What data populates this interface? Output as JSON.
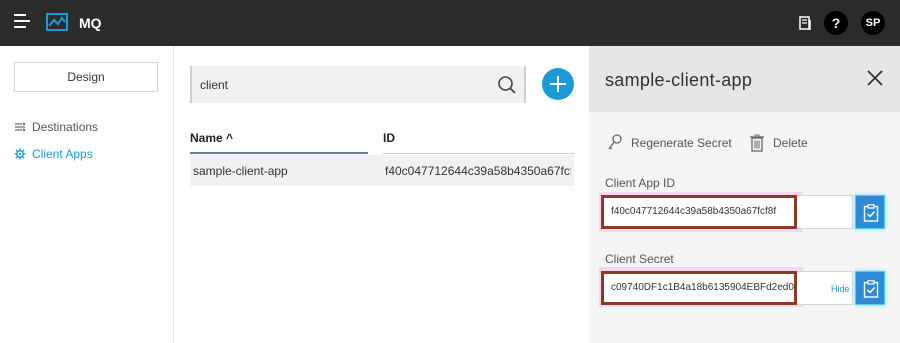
{
  "app": {
    "brand": "MQ",
    "help_label": "?",
    "avatar_initials": "SP"
  },
  "nav": {
    "design_label": "Design",
    "items": [
      {
        "label": "Destinations",
        "icon": "destinations-icon",
        "active": false
      },
      {
        "label": "Client Apps",
        "icon": "gear-icon",
        "active": true
      }
    ]
  },
  "search": {
    "value": "client",
    "placeholder": ""
  },
  "table": {
    "headers": {
      "name": "Name ^",
      "id": "ID"
    },
    "rows": [
      {
        "name": "sample-client-app",
        "id": "f40c047712644c39a58b4350a67fcf..."
      }
    ]
  },
  "panel": {
    "title": "sample-client-app",
    "regenerate_label": "Regenerate Secret",
    "delete_label": "Delete",
    "client_app_id_label": "Client App ID",
    "client_app_id_value": "f40c047712644c39a58b4350a67fcf8f",
    "client_secret_label": "Client Secret",
    "client_secret_value": "c09740DF1c1B4a18b6135904EBFd2ed0",
    "hide_label": "Hide"
  },
  "colors": {
    "accent": "#1a9bd7",
    "topbar": "#2b2b2b",
    "highlight_border": "#8b3a2a",
    "copy_button": "#2f8ad6"
  }
}
